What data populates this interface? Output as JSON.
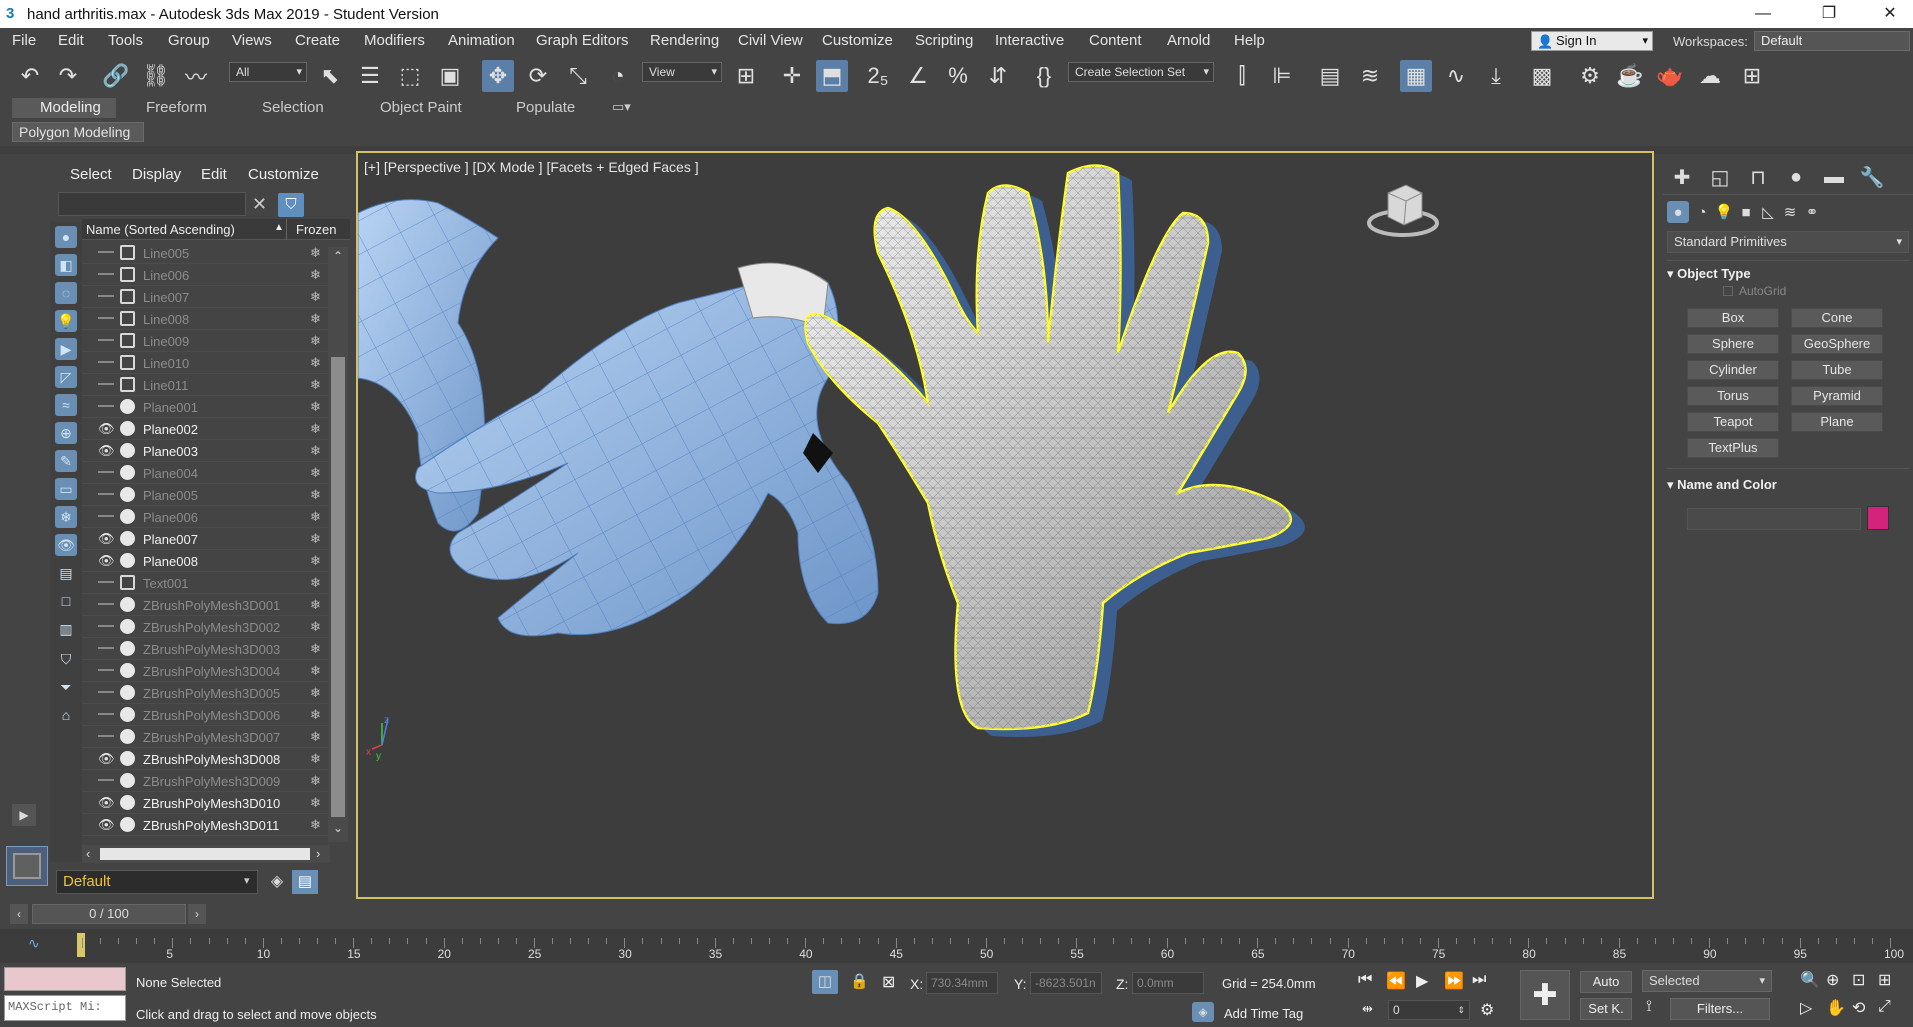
{
  "window": {
    "title": "hand arthritis.max - Autodesk 3ds Max 2019 - Student Version",
    "app_icon": "3",
    "minimize": "—",
    "maximize": "❐",
    "close": "✕"
  },
  "menu": [
    "File",
    "Edit",
    "Tools",
    "Group",
    "Views",
    "Create",
    "Modifiers",
    "Animation",
    "Graph Editors",
    "Rendering",
    "Civil View",
    "Customize",
    "Scripting",
    "Interactive",
    "Content",
    "Arnold",
    "Help"
  ],
  "signin": {
    "label": "Sign In"
  },
  "workspaces": {
    "label": "Workspaces:",
    "value": "Default"
  },
  "toolbar": {
    "selection_filter": "All",
    "ref_coord": "View",
    "selection_set": "Create Selection Set"
  },
  "ribbon": {
    "tabs": [
      "Modeling",
      "Freeform",
      "Selection",
      "Object Paint",
      "Populate"
    ],
    "active_tab": "Modeling",
    "panel": "Polygon Modeling"
  },
  "explorer": {
    "menus": [
      "Select",
      "Display",
      "Edit",
      "Customize"
    ],
    "col_name": "Name (Sorted Ascending)",
    "col_frozen": "Frozen",
    "rows": [
      {
        "name": "Line005",
        "visible": false,
        "kind": "shape"
      },
      {
        "name": "Line006",
        "visible": false,
        "kind": "shape"
      },
      {
        "name": "Line007",
        "visible": false,
        "kind": "shape"
      },
      {
        "name": "Line008",
        "visible": false,
        "kind": "shape"
      },
      {
        "name": "Line009",
        "visible": false,
        "kind": "shape"
      },
      {
        "name": "Line010",
        "visible": false,
        "kind": "shape"
      },
      {
        "name": "Line011",
        "visible": false,
        "kind": "shape"
      },
      {
        "name": "Plane001",
        "visible": false,
        "kind": "geo"
      },
      {
        "name": "Plane002",
        "visible": true,
        "kind": "geo"
      },
      {
        "name": "Plane003",
        "visible": true,
        "kind": "geo"
      },
      {
        "name": "Plane004",
        "visible": false,
        "kind": "geo"
      },
      {
        "name": "Plane005",
        "visible": false,
        "kind": "geo"
      },
      {
        "name": "Plane006",
        "visible": false,
        "kind": "geo"
      },
      {
        "name": "Plane007",
        "visible": true,
        "kind": "geo"
      },
      {
        "name": "Plane008",
        "visible": true,
        "kind": "geo"
      },
      {
        "name": "Text001",
        "visible": false,
        "kind": "shape"
      },
      {
        "name": "ZBrushPolyMesh3D001",
        "visible": false,
        "kind": "geo"
      },
      {
        "name": "ZBrushPolyMesh3D002",
        "visible": false,
        "kind": "geo"
      },
      {
        "name": "ZBrushPolyMesh3D003",
        "visible": false,
        "kind": "geo"
      },
      {
        "name": "ZBrushPolyMesh3D004",
        "visible": false,
        "kind": "geo"
      },
      {
        "name": "ZBrushPolyMesh3D005",
        "visible": false,
        "kind": "geo"
      },
      {
        "name": "ZBrushPolyMesh3D006",
        "visible": false,
        "kind": "geo"
      },
      {
        "name": "ZBrushPolyMesh3D007",
        "visible": false,
        "kind": "geo"
      },
      {
        "name": "ZBrushPolyMesh3D008",
        "visible": true,
        "kind": "geo"
      },
      {
        "name": "ZBrushPolyMesh3D009",
        "visible": false,
        "kind": "geo"
      },
      {
        "name": "ZBrushPolyMesh3D010",
        "visible": true,
        "kind": "geo"
      },
      {
        "name": "ZBrushPolyMesh3D011",
        "visible": true,
        "kind": "geo"
      }
    ],
    "layer": "Default"
  },
  "viewport": {
    "label": "[+] [Perspective ] [DX Mode ] [Facets + Edged Faces ]",
    "axis_x": "x",
    "axis_y": "y",
    "axis_z": "z"
  },
  "command_panel": {
    "category": "Standard Primitives",
    "object_type_title": "Object Type",
    "autogrid": "AutoGrid",
    "buttons": [
      "Box",
      "Cone",
      "Sphere",
      "GeoSphere",
      "Cylinder",
      "Tube",
      "Torus",
      "Pyramid",
      "Teapot",
      "Plane",
      "TextPlus"
    ],
    "name_color_title": "Name and Color",
    "object_color": "#d4237a"
  },
  "timeline": {
    "frame": "0 / 100",
    "ticks": [
      "5",
      "10",
      "15",
      "20",
      "25",
      "30",
      "35",
      "40",
      "45",
      "50",
      "55",
      "60",
      "65",
      "70",
      "75",
      "80",
      "85",
      "90",
      "95",
      "100"
    ]
  },
  "status": {
    "maxscript": "MAXScript Mi:",
    "selection": "None Selected",
    "prompt": "Click and drag to select and move objects",
    "x_label": "X:",
    "x_value": "730.34mm",
    "y_label": "Y:",
    "y_value": "-8623.501n",
    "z_label": "Z:",
    "z_value": "0.0mm",
    "grid": "Grid = 254.0mm",
    "add_time_tag": "Add Time Tag",
    "auto_key": "Auto",
    "set_key": "Set K.",
    "key_filter_sel": "Selected",
    "filters": "Filters...",
    "current_frame": "0"
  }
}
